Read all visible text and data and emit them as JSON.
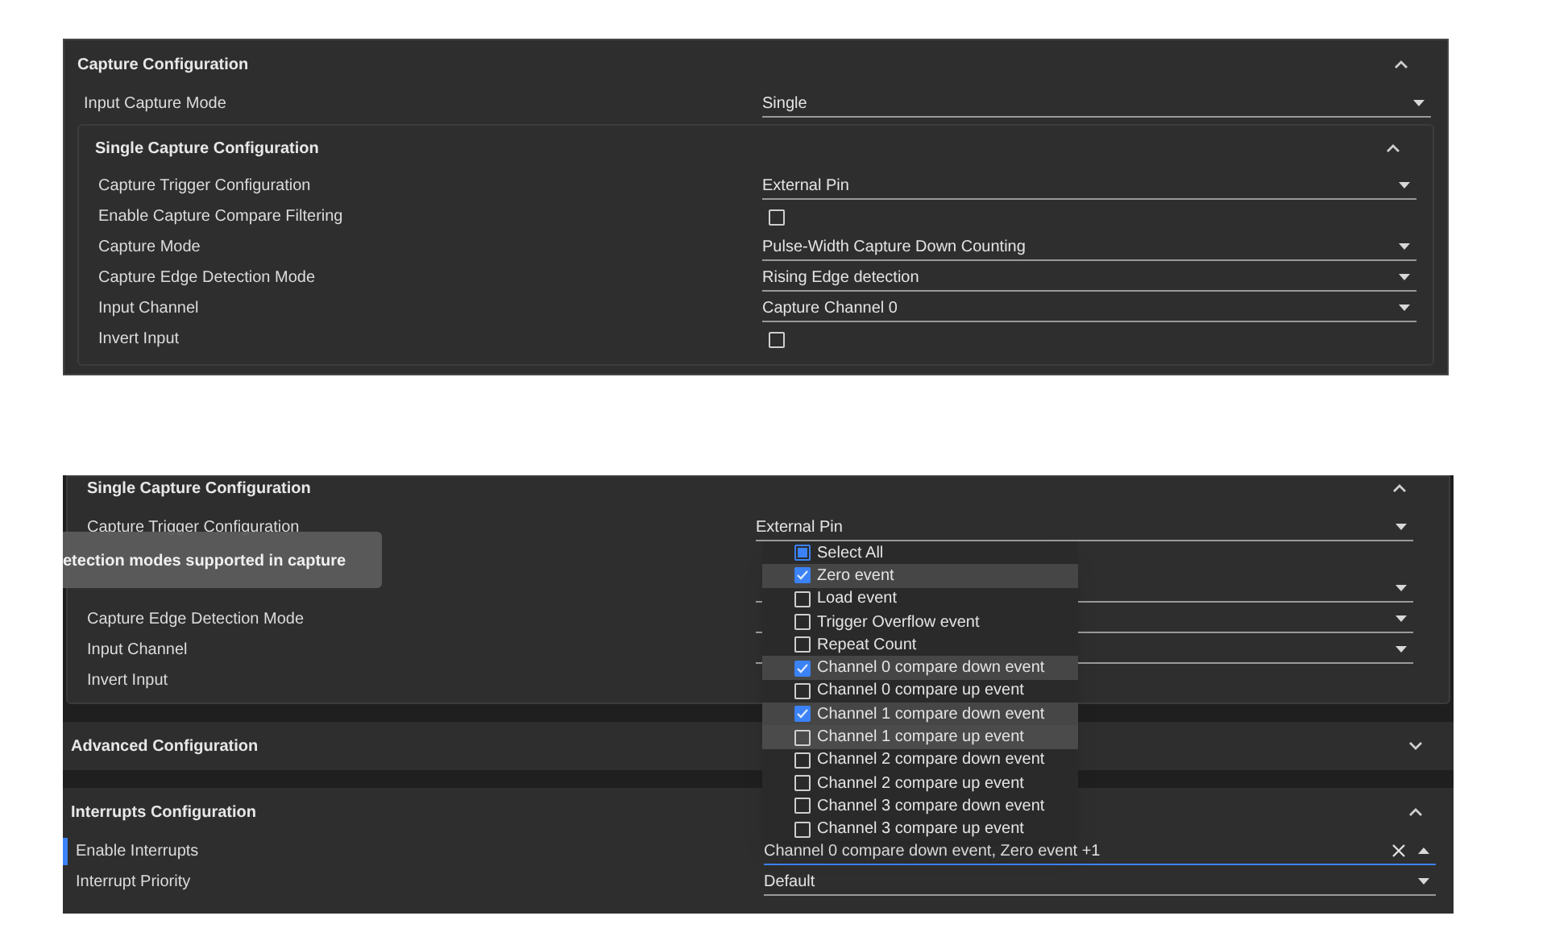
{
  "top": {
    "title": "Capture Configuration",
    "expanded": true,
    "fields": [
      {
        "kind": "select",
        "label": "Input Capture Mode",
        "value": "Single"
      }
    ],
    "subsection": {
      "title": "Single Capture Configuration",
      "expanded": true,
      "fields": [
        {
          "kind": "select",
          "label": "Capture Trigger Configuration",
          "value": "External Pin"
        },
        {
          "kind": "checkbox",
          "label": "Enable Capture Compare Filtering",
          "checked": false
        },
        {
          "kind": "select",
          "label": "Capture Mode",
          "value": "Pulse-Width Capture Down Counting"
        },
        {
          "kind": "select",
          "label": "Capture Edge Detection Mode",
          "value": "Rising Edge detection"
        },
        {
          "kind": "select",
          "label": "Input Channel",
          "value": "Capture Channel 0"
        },
        {
          "kind": "checkbox",
          "label": "Invert Input",
          "checked": false
        }
      ]
    }
  },
  "bottom": {
    "subsection": {
      "title": "Single Capture Configuration",
      "expanded": true,
      "fields": [
        {
          "kind": "select",
          "label": "Capture Trigger Configuration",
          "value": "External Pin"
        },
        {
          "kind": "hidden"
        },
        {
          "kind": "select"
        },
        {
          "kind": "select",
          "label": "Capture Edge Detection Mode"
        },
        {
          "kind": "select",
          "label": "Input Channel"
        },
        {
          "kind": "label",
          "label": "Invert Input"
        }
      ]
    },
    "tooltip": "etection modes supported in capture",
    "sections": [
      {
        "title": "Advanced Configuration",
        "expanded": false
      },
      {
        "title": "Interrupts Configuration",
        "expanded": true,
        "fields": [
          {
            "kind": "multiselect",
            "label": "Enable Interrupts",
            "value": "Channel 0 compare down event, Zero event +1",
            "focused": true
          },
          {
            "kind": "select",
            "label": "Interrupt Priority",
            "value": "Default",
            "focused": false
          }
        ]
      }
    ],
    "dropdown": {
      "select_all": {
        "label": "Select All",
        "indeterminate": true
      },
      "options": [
        {
          "label": "Zero event",
          "checked": true,
          "hovered": false
        },
        {
          "label": "Load event",
          "checked": false,
          "hovered": false
        },
        {
          "label": "Trigger Overflow event",
          "checked": false,
          "hovered": false
        },
        {
          "label": "Repeat Count",
          "checked": false,
          "hovered": false
        },
        {
          "label": "Channel 0 compare down event",
          "checked": true,
          "hovered": false
        },
        {
          "label": "Channel 0 compare up event",
          "checked": false,
          "hovered": false
        },
        {
          "label": "Channel 1 compare down event",
          "checked": true,
          "hovered": false
        },
        {
          "label": "Channel 1 compare up event",
          "checked": false,
          "hovered": true
        },
        {
          "label": "Channel 2 compare down event",
          "checked": false,
          "hovered": false
        },
        {
          "label": "Channel 2 compare up event",
          "checked": false,
          "hovered": false
        },
        {
          "label": "Channel 3 compare down event",
          "checked": false,
          "hovered": false
        },
        {
          "label": "Channel 3 compare up event",
          "checked": false,
          "hovered": false
        }
      ]
    }
  }
}
